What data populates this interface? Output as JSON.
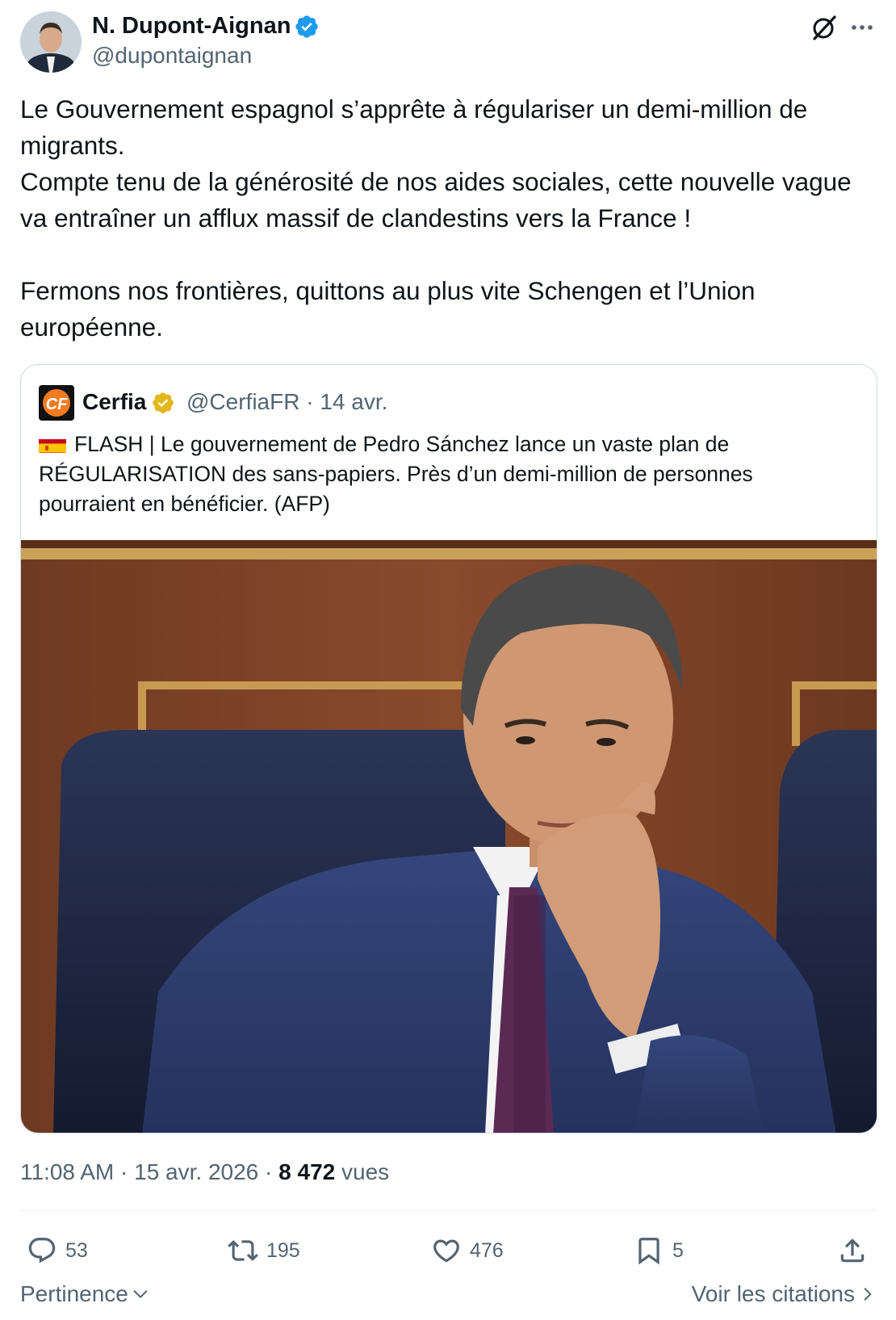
{
  "author": {
    "name": "N. Dupont-Aignan",
    "handle": "@dupontaignan"
  },
  "tweet": {
    "paragraphs": [
      "Le Gouvernement espagnol s’apprête à régulariser un demi-million de migrants.",
      "Compte tenu de la générosité de nos aides sociales, cette nouvelle vague va entraîner un afflux massif de clandestins vers la France !",
      "Fermons nos frontières, quittons au plus vite Schengen et l’Union européenne."
    ]
  },
  "quote": {
    "name": "Cerfia",
    "handle": "@CerfiaFR",
    "date": "14 avr.",
    "text": "FLASH | Le gouvernement de Pedro Sánchez lance un vaste plan de RÉGULARISATION des sans-papiers. Près d’un demi-million de personnes pourraient en bénéficier. (AFP)"
  },
  "meta": {
    "time": "11:08 AM",
    "date": "15 avr. 2026",
    "views_count": "8 472",
    "views_label": "vues"
  },
  "actions": {
    "replies": "53",
    "reposts": "195",
    "likes": "476",
    "bookmarks": "5"
  },
  "footer": {
    "sort_label": "Pertinence",
    "citations_label": "Voir les citations"
  },
  "colors": {
    "text": "#0f1419",
    "secondary": "#536471",
    "verified_blue": "#1d9bf0",
    "verified_gold": "#e2b719",
    "border": "#cfd9de"
  },
  "icons": [
    "verified-badge-icon",
    "grok-icon",
    "more-icon",
    "reply-icon",
    "repost-icon",
    "like-icon",
    "bookmark-icon",
    "share-icon",
    "chevron-down-icon",
    "chevron-right-icon"
  ]
}
